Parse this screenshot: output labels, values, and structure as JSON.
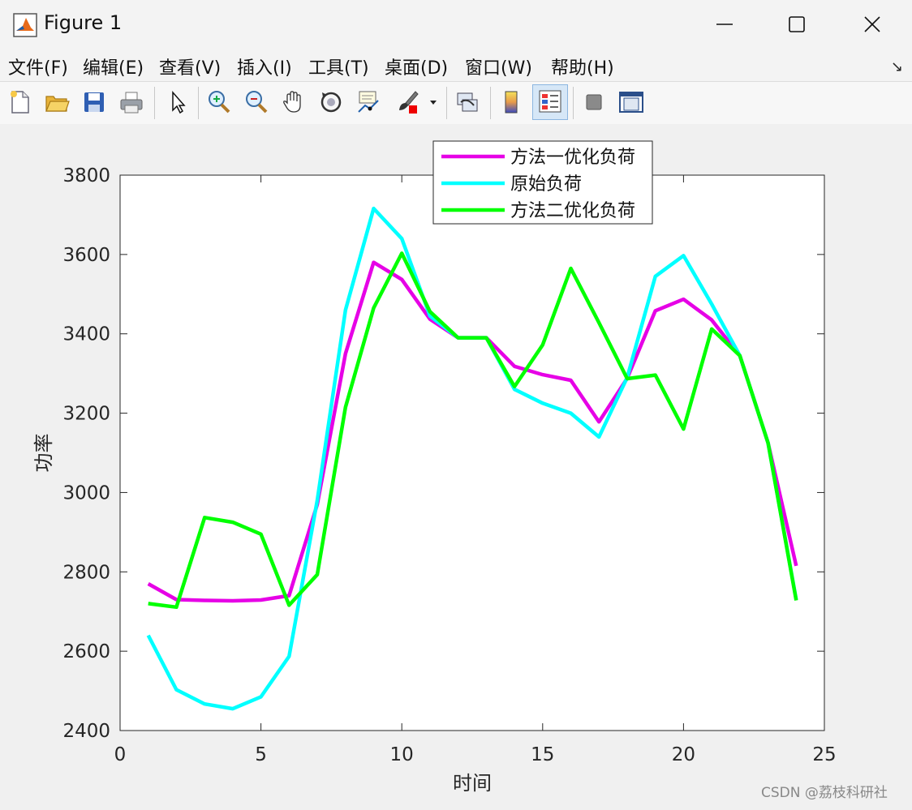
{
  "window": {
    "title": "Figure 1"
  },
  "menu": {
    "items": [
      "文件(F)",
      "编辑(E)",
      "查看(V)",
      "插入(I)",
      "工具(T)",
      "桌面(D)",
      "窗口(W)",
      "帮助(H)"
    ],
    "arrow": "↘"
  },
  "toolbar": {
    "tools": [
      "new-figure-icon",
      "open-file-icon",
      "save-icon",
      "print-icon",
      "select-arrow-icon",
      "zoom-in-icon",
      "zoom-out-icon",
      "pan-hand-icon",
      "rotate-3d-icon",
      "data-cursor-icon",
      "brush-icon",
      "brush-dropdown-icon",
      "link-plot-icon",
      "colorbar-icon",
      "legend-icon",
      "hide-plot-tools-icon",
      "show-plot-tools-icon"
    ]
  },
  "colors": {
    "series1": "#e600e6",
    "series2": "#00ffff",
    "series3": "#00ff00"
  },
  "watermark": "CSDN @荔枝科研社",
  "chart_data": {
    "type": "line",
    "title": "",
    "xlabel": "时间",
    "ylabel": "功率",
    "xlim": [
      0,
      25
    ],
    "ylim": [
      2400,
      3800
    ],
    "xticks": [
      0,
      5,
      10,
      15,
      20,
      25
    ],
    "yticks": [
      2400,
      2600,
      2800,
      3000,
      3200,
      3400,
      3600,
      3800
    ],
    "legend_position": "top-center",
    "grid": false,
    "x": [
      1,
      2,
      3,
      4,
      5,
      6,
      7,
      8,
      9,
      10,
      11,
      12,
      13,
      14,
      15,
      16,
      17,
      18,
      19,
      20,
      21,
      22,
      23,
      24
    ],
    "series": [
      {
        "name": "方法一优化负荷",
        "color": "#e600e6",
        "values": [
          2770,
          2730,
          2728,
          2727,
          2729,
          2740,
          2970,
          3350,
          3580,
          3537,
          3437,
          3390,
          3390,
          3318,
          3297,
          3283,
          3178,
          3288,
          3458,
          3487,
          3435,
          3345,
          3125,
          2815
        ]
      },
      {
        "name": "原始负荷",
        "color": "#00ffff",
        "values": [
          2640,
          2503,
          2467,
          2455,
          2485,
          2587,
          2980,
          3460,
          3716,
          3640,
          3445,
          3390,
          3390,
          3260,
          3225,
          3200,
          3140,
          3290,
          3545,
          3597,
          3475,
          3345,
          3125,
          2730
        ]
      },
      {
        "name": "方法二优化负荷",
        "color": "#00ff00",
        "values": [
          2720,
          2711,
          2937,
          2925,
          2895,
          2716,
          2793,
          3215,
          3465,
          3603,
          3456,
          3390,
          3390,
          3267,
          3372,
          3565,
          3428,
          3287,
          3296,
          3160,
          3412,
          3345,
          3125,
          2728
        ]
      }
    ]
  }
}
